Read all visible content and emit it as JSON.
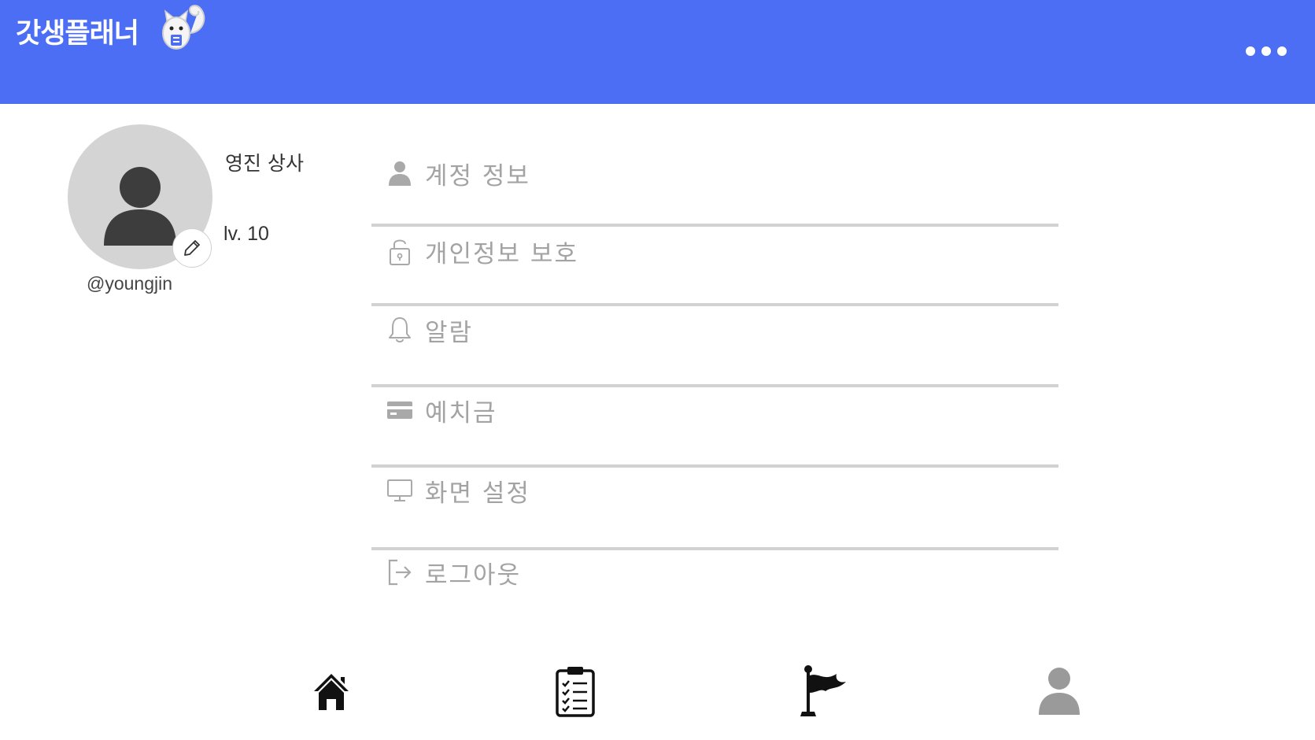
{
  "app": {
    "title": "갓생플래너",
    "accent_color": "#4c6ef5"
  },
  "profile": {
    "name": "영진 상사",
    "level": "lv. 10",
    "handle": "@youngjin"
  },
  "menu": {
    "items": [
      {
        "label": "계정 정보",
        "icon": "person-icon"
      },
      {
        "label": "개인정보 보호",
        "icon": "unlock-icon"
      },
      {
        "label": "알람",
        "icon": "bell-icon"
      },
      {
        "label": "예치금",
        "icon": "credit-card-icon"
      },
      {
        "label": "화면 설정",
        "icon": "monitor-icon"
      },
      {
        "label": "로그아웃",
        "icon": "logout-icon"
      }
    ]
  },
  "bottom_nav": {
    "items": [
      {
        "icon": "home-icon"
      },
      {
        "icon": "clipboard-checklist-icon"
      },
      {
        "icon": "flag-icon"
      },
      {
        "icon": "person-icon",
        "active": true
      }
    ]
  }
}
